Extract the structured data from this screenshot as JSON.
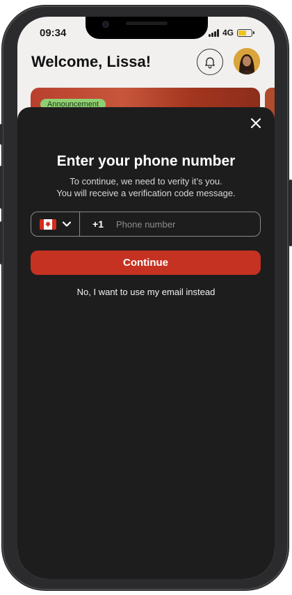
{
  "status_bar": {
    "time": "09:34",
    "network": "4G",
    "battery_level": 0.6,
    "signal_bars": 4
  },
  "header": {
    "greeting": "Welcome,",
    "user_name": "Lissa!"
  },
  "banner": {
    "badge": "Announcement"
  },
  "sheet": {
    "title": "Enter your phone number",
    "subtitle_line1": "To continue, we need to verity it’s you.",
    "subtitle_line2": "You will receive a verification code message.",
    "country": {
      "flag": "canada-flag-icon",
      "dial_code": "+1"
    },
    "phone_input": {
      "value": "",
      "placeholder": "Phone number"
    },
    "continue_label": "Continue",
    "email_link_label": "No, I want to use my email instead"
  },
  "colors": {
    "accent": "#c53222",
    "sheet_background": "#1d1d1d",
    "badge_background": "#8fcf72",
    "battery_fill": "#f0c419"
  },
  "icons": [
    "bell-icon",
    "close-icon",
    "chevron-down-icon",
    "canada-flag-icon",
    "signal-icon",
    "battery-icon"
  ]
}
